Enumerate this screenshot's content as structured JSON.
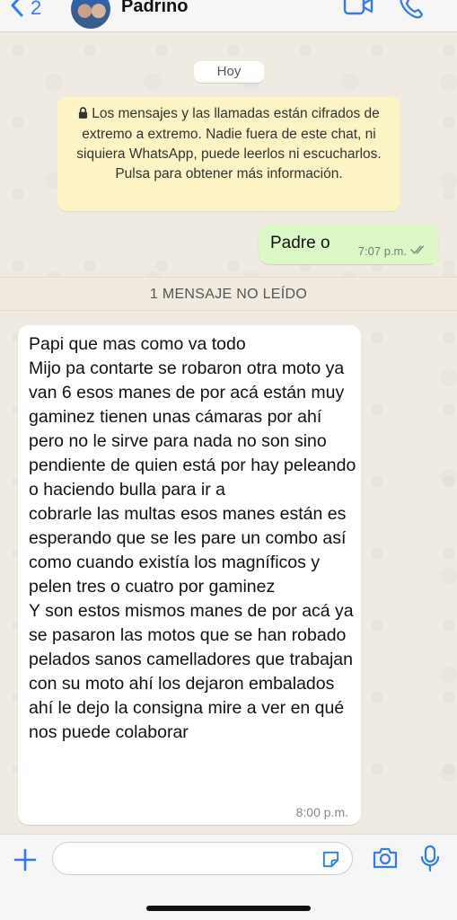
{
  "header": {
    "back_count": "2",
    "contact_name": "Padrino"
  },
  "chat": {
    "day_label": "Hoy",
    "encryption_notice": "Los mensajes y las llamadas están cifrados de extremo a extremo. Nadie fuera de este chat, ni siquiera WhatsApp, puede leerlos ni escucharlos. Pulsa para obtener más información.",
    "outgoing": {
      "text": "Padre o",
      "time": "7:07 p.m."
    },
    "unread_label": "1 MENSAJE NO LEÍDO",
    "incoming": {
      "text": "Papi que mas como va todo\nMijo pa contarte se robaron otra moto ya van 6 esos manes de por acá están muy gaminez tienen unas cámaras por ahí pero no le sirve para nada no son sino pendiente de quien está por hay peleando o haciendo bulla para ir a\ncobrarle las multas esos manes están es esperando que se les pare un combo así como cuando existía los magníficos y pelen tres o cuatro por gaminez\nY son estos mismos manes de por acá ya se pasaron las motos que se han robado pelados sanos camelladores que trabajan con su moto ahí los dejaron embalados ahí le dejo la consigna mire a ver en qué nos puede colaborar",
      "time": "8:00 p.m."
    }
  },
  "composer": {
    "value": ""
  },
  "colors": {
    "accent": "#2f7cf6",
    "outgoing_bubble": "#dcf8c6",
    "incoming_bubble": "#ffffff",
    "notice_bg": "#fcf4c4",
    "wallpaper": "#efeae2"
  },
  "icons": [
    "chevron-left-icon",
    "video-call-icon",
    "phone-icon",
    "lock-icon",
    "double-check-icon",
    "plus-icon",
    "sticker-icon",
    "camera-icon",
    "microphone-icon"
  ]
}
